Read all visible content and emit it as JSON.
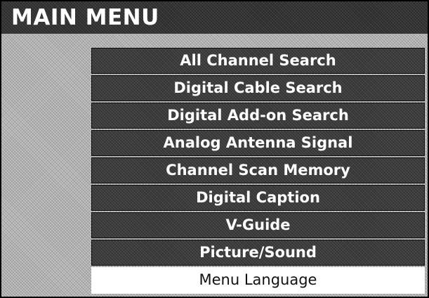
{
  "menu": {
    "title": "MAIN MENU",
    "items": [
      {
        "label": "All Channel Search"
      },
      {
        "label": "Digital Cable Search"
      },
      {
        "label": "Digital Add-on Search"
      },
      {
        "label": "Analog Antenna Signal"
      },
      {
        "label": "Channel Scan Memory"
      },
      {
        "label": "Digital Caption"
      },
      {
        "label": "V-Guide"
      },
      {
        "label": "Picture/Sound"
      },
      {
        "label": "Menu Language",
        "selected": true
      }
    ]
  },
  "colors": {
    "panel_background": "#c4c4c4",
    "title_bar": "#2a2a2a",
    "menu_item_background": "#333333",
    "menu_item_text": "#ffffff",
    "selected_item_background": "#ffffff",
    "selected_item_text": "#111111"
  }
}
